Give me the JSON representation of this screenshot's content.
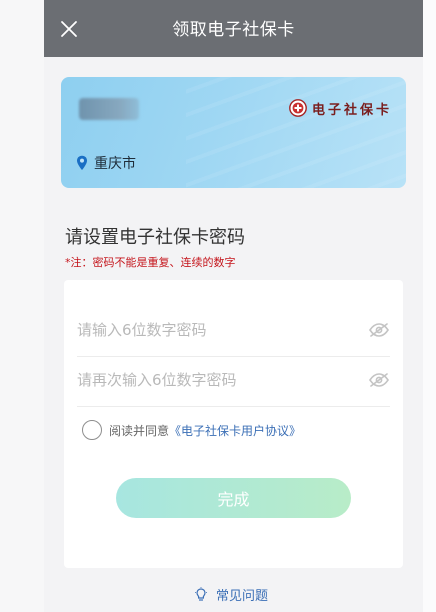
{
  "header": {
    "title": "领取电子社保卡",
    "close_icon": "close-icon"
  },
  "card": {
    "brand_text": "电子社保卡",
    "city": "重庆市",
    "colors": {
      "card": "#9fd7f3",
      "brand": "#7a1e1e"
    }
  },
  "section": {
    "title": "请设置电子社保卡密码",
    "note": "*注：密码不能是重复、连续的数字"
  },
  "form": {
    "password_placeholder": "请输入6位数字密码",
    "confirm_placeholder": "请再次输入6位数字密码",
    "agree_text": "阅读并同意",
    "agree_link": "《电子社保卡用户协议》",
    "submit_label": "完成"
  },
  "footer": {
    "faq_label": "常见问题"
  },
  "colors": {
    "header_bg": "#6b6e73",
    "link": "#3b6fb6",
    "warning": "#c5161d",
    "button_gradient": [
      "#a7e6e0",
      "#b8ecc8"
    ]
  }
}
